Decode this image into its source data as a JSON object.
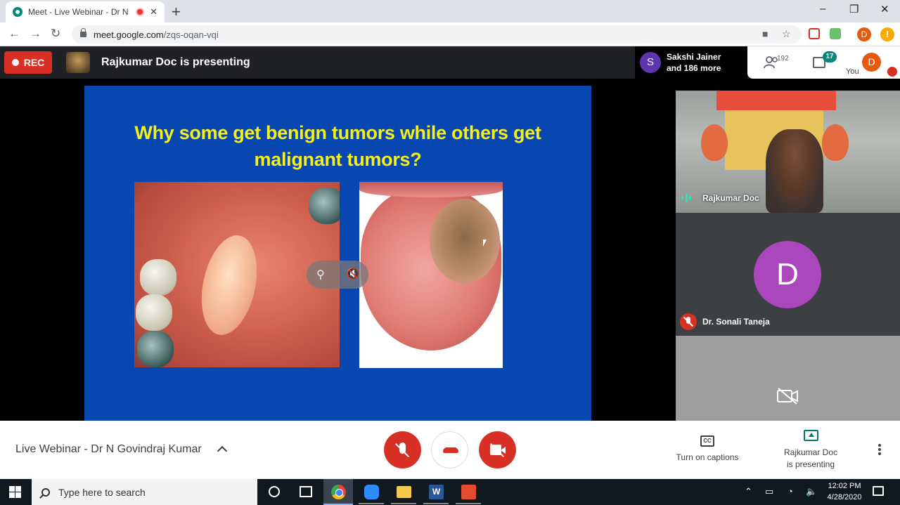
{
  "browser": {
    "tab_title": "Meet - Live Webinar - Dr N G",
    "tab_close": "✕",
    "new_tab": "+",
    "url_host": "meet.google.com",
    "url_path": "/zqs-oqan-vqi",
    "profile_initial": "D",
    "alert_glyph": "!",
    "window_min": "–",
    "window_max": "❐",
    "window_close": "✕"
  },
  "meet": {
    "rec_label": "REC",
    "presenting_banner": "Rajkumar Doc is presenting",
    "joined_initial": "S",
    "joined_line1": "Sakshi Jainer",
    "joined_line2": "and 186 more",
    "people_count": "192",
    "chat_badge": "17",
    "you_initial": "D",
    "you_label": "You"
  },
  "slide": {
    "title_line1": "Why some get benign tumors while others get",
    "title_line2": "malignant tumors?"
  },
  "participants": [
    {
      "name": "Rajkumar Doc",
      "state": "speaking"
    },
    {
      "name": "Dr. Sonali Taneja",
      "initial": "D",
      "avatar_color": "#ab47bc",
      "state": "muted"
    },
    {
      "state": "camera-off"
    }
  ],
  "controls": {
    "meeting_title": "Live Webinar - Dr N Govindraj Kumar",
    "captions_label": "Turn on captions",
    "captions_icon": "CC",
    "present_label_line1": "Rajkumar Doc",
    "present_label_line2": "is presenting"
  },
  "taskbar": {
    "search_placeholder": "Type here to search",
    "word_letter": "W",
    "time": "12:02 PM",
    "date": "4/28/2020"
  },
  "colors": {
    "accent_red": "#d93025",
    "slide_blue": "#0846b0",
    "slide_title": "#f4f01a",
    "meet_teal": "#00897b"
  }
}
